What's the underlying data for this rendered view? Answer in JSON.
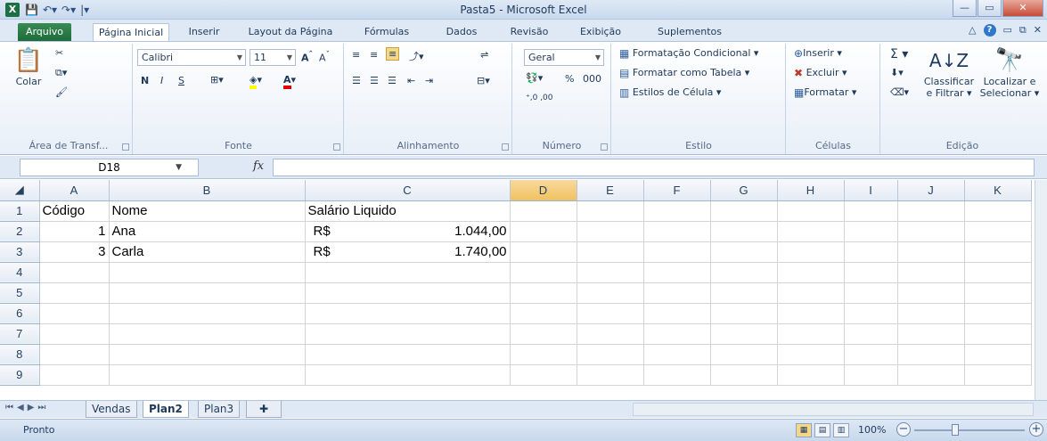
{
  "window": {
    "title": "Pasta5 - Microsoft Excel",
    "app_icon": "X"
  },
  "tabs": [
    "Arquivo",
    "Página Inicial",
    "Inserir",
    "Layout da Página",
    "Fórmulas",
    "Dados",
    "Revisão",
    "Exibição",
    "Suplementos"
  ],
  "active_tab": "Página Inicial",
  "ribbon": {
    "clipboard": {
      "paste": "Colar",
      "label": "Área de Transf..."
    },
    "font": {
      "name": "Calibri",
      "size": "11",
      "bold": "N",
      "italic": "I",
      "underline": "S",
      "label": "Fonte"
    },
    "alignment": {
      "label": "Alinhamento"
    },
    "number": {
      "format": "Geral",
      "percent": "%",
      "thousands": "000",
      "label": "Número"
    },
    "styles": {
      "conditional": "Formatação Condicional",
      "as_table": "Formatar como Tabela",
      "cell_styles": "Estilos de Célula",
      "label": "Estilo"
    },
    "cells": {
      "insert": "Inserir",
      "delete": "Excluir",
      "format": "Formatar",
      "label": "Células"
    },
    "editing": {
      "sort_filter_1": "Classificar",
      "sort_filter_2": "e Filtrar",
      "find_1": "Localizar e",
      "find_2": "Selecionar",
      "label": "Edição"
    }
  },
  "formula_bar": {
    "name_box": "D18",
    "fx": "fx",
    "formula": ""
  },
  "sheet": {
    "columns": [
      "A",
      "B",
      "C",
      "D",
      "E",
      "F",
      "G",
      "H",
      "I",
      "J",
      "K"
    ],
    "selected_column": "D",
    "rows": [
      {
        "n": "1",
        "A": "Código",
        "B": "Nome",
        "C1": "Salário Liquido",
        "C2": ""
      },
      {
        "n": "2",
        "A": "1",
        "B": "Ana",
        "C1": "R$",
        "C2": "1.044,00"
      },
      {
        "n": "3",
        "A": "3",
        "B": "Carla",
        "C1": "R$",
        "C2": "1.740,00"
      },
      {
        "n": "4",
        "A": "",
        "B": "",
        "C1": "",
        "C2": ""
      },
      {
        "n": "5",
        "A": "",
        "B": "",
        "C1": "",
        "C2": ""
      },
      {
        "n": "6",
        "A": "",
        "B": "",
        "C1": "",
        "C2": ""
      },
      {
        "n": "7",
        "A": "",
        "B": "",
        "C1": "",
        "C2": ""
      },
      {
        "n": "8",
        "A": "",
        "B": "",
        "C1": "",
        "C2": ""
      },
      {
        "n": "9",
        "A": "",
        "B": "",
        "C1": "",
        "C2": ""
      }
    ]
  },
  "sheet_tabs": [
    "Vendas",
    "Plan2",
    "Plan3"
  ],
  "active_sheet": "Plan2",
  "status": {
    "text": "Pronto",
    "zoom": "100%"
  }
}
